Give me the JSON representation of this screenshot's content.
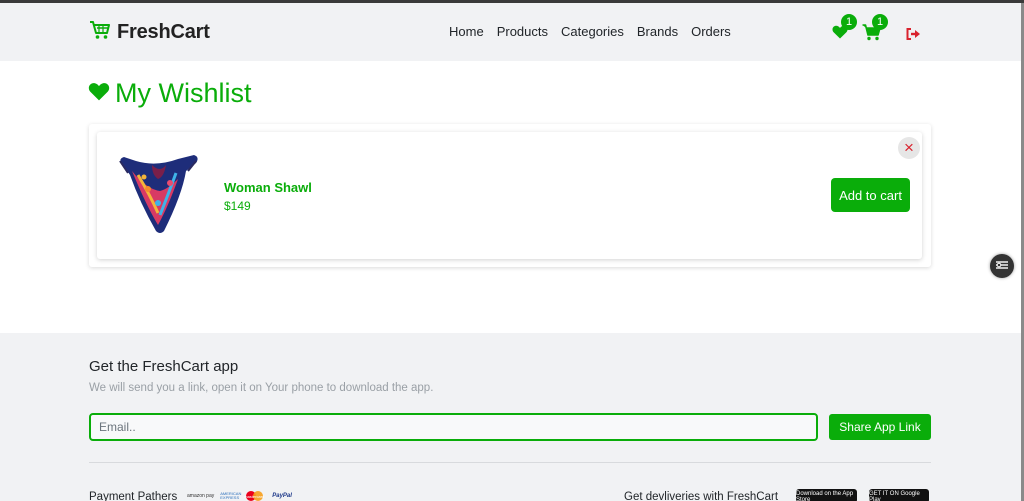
{
  "navbar": {
    "brand": "FreshCart",
    "links": [
      "Home",
      "Products",
      "Categories",
      "Brands",
      "Orders"
    ],
    "wishlist_count": "1",
    "cart_count": "1"
  },
  "wishlist": {
    "title": "My Wishlist",
    "items": [
      {
        "name": "Woman Shawl",
        "price": "$149",
        "remove": "×",
        "add_label": "Add to cart"
      }
    ]
  },
  "footer": {
    "title": "Get the FreshCart app",
    "subtitle": "We will send you a link, open it on Your phone to download the app.",
    "email_placeholder": "Email..",
    "share_label": "Share App Link",
    "payment_label": "Payment Pathers",
    "payment_logos": [
      "amazon pay",
      "AMERICAN EXPRESS",
      "mastercard",
      "PayPal"
    ],
    "delivery_label": "Get devliveries with FreshCart",
    "stores": [
      "Download on the App Store",
      "GET IT ON Google Play"
    ]
  },
  "colors": {
    "accent": "#0aad0a",
    "danger": "#d9232e",
    "footer_bg": "#f1f2f4"
  }
}
